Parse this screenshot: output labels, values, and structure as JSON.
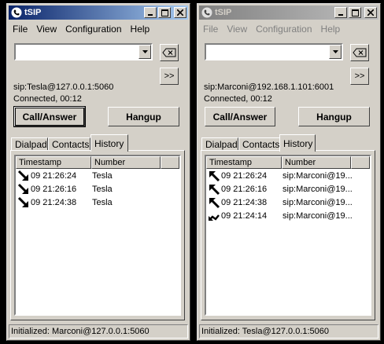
{
  "windows": [
    {
      "title": "tSIP",
      "active": true,
      "menu": [
        "File",
        "View",
        "Configuration",
        "Help"
      ],
      "dial_input_value": "",
      "backspace_label": "⌫",
      "more_label": ">>",
      "account_uri": "sip:Tesla@127.0.0.1:5060",
      "call_status": "Connected, 00:12",
      "call_button": "Call/Answer",
      "hangup_button": "Hangup",
      "tabs": [
        "Dialpad",
        "Contacts",
        "History"
      ],
      "selected_tab": "History",
      "history": {
        "columns": [
          "Timestamp",
          "Number"
        ],
        "rows": [
          {
            "direction": "incoming",
            "timestamp": "09  21:26:24",
            "number": "Tesla"
          },
          {
            "direction": "incoming",
            "timestamp": "09  21:26:16",
            "number": "Tesla"
          },
          {
            "direction": "incoming",
            "timestamp": "09  21:24:38",
            "number": "Tesla"
          }
        ]
      },
      "status_bar": "Initialized: Marconi@127.0.0.1:5060"
    },
    {
      "title": "tSIP",
      "active": false,
      "menu": [
        "File",
        "View",
        "Configuration",
        "Help"
      ],
      "dial_input_value": "",
      "backspace_label": "⌫",
      "more_label": ">>",
      "account_uri": "sip:Marconi@192.168.1.101:6001",
      "call_status": "Connected, 00:12",
      "call_button": "Call/Answer",
      "hangup_button": "Hangup",
      "tabs": [
        "Dialpad",
        "Contacts",
        "History"
      ],
      "selected_tab": "History",
      "history": {
        "columns": [
          "Timestamp",
          "Number"
        ],
        "rows": [
          {
            "direction": "outgoing",
            "timestamp": "09  21:26:24",
            "number": "sip:Marconi@19..."
          },
          {
            "direction": "outgoing",
            "timestamp": "09  21:26:16",
            "number": "sip:Marconi@19..."
          },
          {
            "direction": "outgoing",
            "timestamp": "09  21:24:38",
            "number": "sip:Marconi@19..."
          },
          {
            "direction": "missed",
            "timestamp": "09  21:24:14",
            "number": "sip:Marconi@19..."
          }
        ]
      },
      "status_bar": "Initialized: Tesla@127.0.0.1:5060"
    }
  ],
  "colors": {
    "active_title": "#0a246a",
    "inactive_title": "#808080",
    "face": "#d4d0c8"
  }
}
